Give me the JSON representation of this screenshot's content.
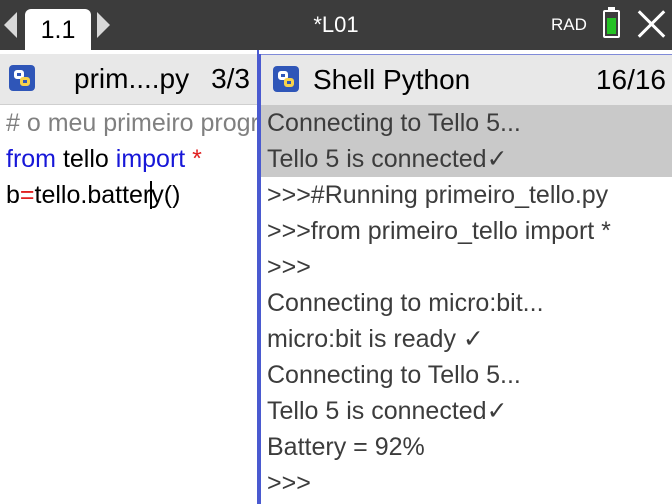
{
  "topbar": {
    "page_tab": "1.1",
    "document_title": "*L01",
    "angle_mode": "RAD",
    "battery_level": 0.8,
    "battery_color": "#24c224"
  },
  "editor": {
    "file_name": "prim....py",
    "line_count": "3/3",
    "lines": [
      {
        "comment": "# o meu primeiro programa"
      },
      {
        "kw1": "from",
        "id1": " tello ",
        "kw2": "import",
        "op": " *"
      },
      {
        "id1": "b",
        "op": "=",
        "id2": "tello.batter",
        "id3": "y()"
      }
    ]
  },
  "shell": {
    "title": "Shell Python",
    "line_count": "16/16",
    "lines": [
      "Connecting to Tello 5...",
      "Tello 5 is connected✓",
      ">>>#Running primeiro_tello.py",
      ">>>from primeiro_tello import *",
      ">>>",
      "Connecting to micro:bit...",
      "micro:bit is ready ✓",
      "Connecting to Tello 5...",
      "Tello 5 is connected✓",
      "Battery = 92%",
      ">>>"
    ]
  },
  "colors": {
    "keyword": "#1717d8",
    "operator": "#e02020",
    "comment": "#808080",
    "accent_border": "#4a5ad0"
  }
}
